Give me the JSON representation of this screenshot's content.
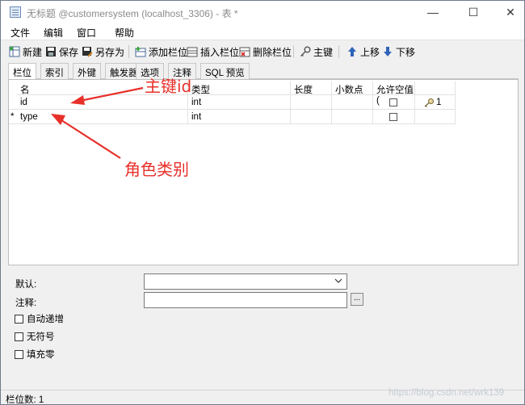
{
  "window": {
    "title": "无标题 @customersystem (localhost_3306) - 表 *",
    "minimize": "—",
    "maximize": "☐",
    "close": "✕"
  },
  "menu": [
    "文件",
    "编辑",
    "窗口",
    "帮助"
  ],
  "toolbar": {
    "new": "新建",
    "save": "保存",
    "save_as": "另存为",
    "add_field": "添加栏位",
    "insert_field": "插入栏位",
    "delete_field": "删除栏位",
    "primary_key": "主键",
    "move_up": "上移",
    "move_down": "下移"
  },
  "tabs": [
    "栏位",
    "索引",
    "外键",
    "触发器",
    "选项",
    "注释",
    "SQL 预览"
  ],
  "grid": {
    "headers": [
      "名",
      "类型",
      "长度",
      "小数点",
      "允许空值 (",
      ""
    ],
    "rows": [
      {
        "marker": "",
        "name": "id",
        "type": "int",
        "length": "",
        "decimals": "",
        "nullable": false,
        "key": "1"
      },
      {
        "marker": "*",
        "name": "type",
        "type": "int",
        "length": "",
        "decimals": "",
        "nullable": false,
        "key": ""
      }
    ]
  },
  "annotations": {
    "primary_key_note": "主键id",
    "role_type_note": "角色类别"
  },
  "properties": {
    "default_label": "默认:",
    "comment_label": "注释:",
    "browse_button": "...",
    "auto_increment": "自动递增",
    "unsigned": "无符号",
    "zerofill": "填充零"
  },
  "status": {
    "field_count": "栏位数: 1"
  },
  "watermark": "https://blog.csdn.net/wrk139"
}
